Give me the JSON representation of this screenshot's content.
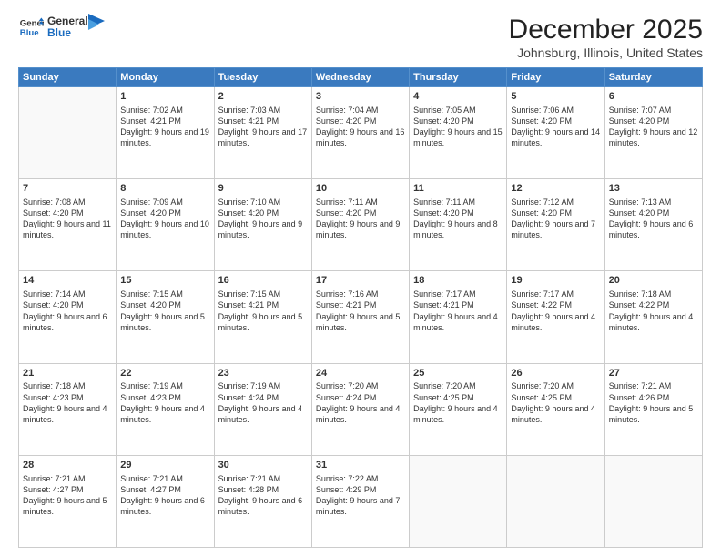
{
  "logo": {
    "line1": "General",
    "line2": "Blue"
  },
  "title": "December 2025",
  "location": "Johnsburg, Illinois, United States",
  "days_header": [
    "Sunday",
    "Monday",
    "Tuesday",
    "Wednesday",
    "Thursday",
    "Friday",
    "Saturday"
  ],
  "weeks": [
    [
      {
        "day": "",
        "empty": true
      },
      {
        "day": "1",
        "sunrise": "7:02 AM",
        "sunset": "4:21 PM",
        "daylight": "9 hours and 19 minutes."
      },
      {
        "day": "2",
        "sunrise": "7:03 AM",
        "sunset": "4:21 PM",
        "daylight": "9 hours and 17 minutes."
      },
      {
        "day": "3",
        "sunrise": "7:04 AM",
        "sunset": "4:20 PM",
        "daylight": "9 hours and 16 minutes."
      },
      {
        "day": "4",
        "sunrise": "7:05 AM",
        "sunset": "4:20 PM",
        "daylight": "9 hours and 15 minutes."
      },
      {
        "day": "5",
        "sunrise": "7:06 AM",
        "sunset": "4:20 PM",
        "daylight": "9 hours and 14 minutes."
      },
      {
        "day": "6",
        "sunrise": "7:07 AM",
        "sunset": "4:20 PM",
        "daylight": "9 hours and 12 minutes."
      }
    ],
    [
      {
        "day": "7",
        "sunrise": "7:08 AM",
        "sunset": "4:20 PM",
        "daylight": "9 hours and 11 minutes."
      },
      {
        "day": "8",
        "sunrise": "7:09 AM",
        "sunset": "4:20 PM",
        "daylight": "9 hours and 10 minutes."
      },
      {
        "day": "9",
        "sunrise": "7:10 AM",
        "sunset": "4:20 PM",
        "daylight": "9 hours and 9 minutes."
      },
      {
        "day": "10",
        "sunrise": "7:11 AM",
        "sunset": "4:20 PM",
        "daylight": "9 hours and 9 minutes."
      },
      {
        "day": "11",
        "sunrise": "7:11 AM",
        "sunset": "4:20 PM",
        "daylight": "9 hours and 8 minutes."
      },
      {
        "day": "12",
        "sunrise": "7:12 AM",
        "sunset": "4:20 PM",
        "daylight": "9 hours and 7 minutes."
      },
      {
        "day": "13",
        "sunrise": "7:13 AM",
        "sunset": "4:20 PM",
        "daylight": "9 hours and 6 minutes."
      }
    ],
    [
      {
        "day": "14",
        "sunrise": "7:14 AM",
        "sunset": "4:20 PM",
        "daylight": "9 hours and 6 minutes."
      },
      {
        "day": "15",
        "sunrise": "7:15 AM",
        "sunset": "4:20 PM",
        "daylight": "9 hours and 5 minutes."
      },
      {
        "day": "16",
        "sunrise": "7:15 AM",
        "sunset": "4:21 PM",
        "daylight": "9 hours and 5 minutes."
      },
      {
        "day": "17",
        "sunrise": "7:16 AM",
        "sunset": "4:21 PM",
        "daylight": "9 hours and 5 minutes."
      },
      {
        "day": "18",
        "sunrise": "7:17 AM",
        "sunset": "4:21 PM",
        "daylight": "9 hours and 4 minutes."
      },
      {
        "day": "19",
        "sunrise": "7:17 AM",
        "sunset": "4:22 PM",
        "daylight": "9 hours and 4 minutes."
      },
      {
        "day": "20",
        "sunrise": "7:18 AM",
        "sunset": "4:22 PM",
        "daylight": "9 hours and 4 minutes."
      }
    ],
    [
      {
        "day": "21",
        "sunrise": "7:18 AM",
        "sunset": "4:23 PM",
        "daylight": "9 hours and 4 minutes."
      },
      {
        "day": "22",
        "sunrise": "7:19 AM",
        "sunset": "4:23 PM",
        "daylight": "9 hours and 4 minutes."
      },
      {
        "day": "23",
        "sunrise": "7:19 AM",
        "sunset": "4:24 PM",
        "daylight": "9 hours and 4 minutes."
      },
      {
        "day": "24",
        "sunrise": "7:20 AM",
        "sunset": "4:24 PM",
        "daylight": "9 hours and 4 minutes."
      },
      {
        "day": "25",
        "sunrise": "7:20 AM",
        "sunset": "4:25 PM",
        "daylight": "9 hours and 4 minutes."
      },
      {
        "day": "26",
        "sunrise": "7:20 AM",
        "sunset": "4:25 PM",
        "daylight": "9 hours and 4 minutes."
      },
      {
        "day": "27",
        "sunrise": "7:21 AM",
        "sunset": "4:26 PM",
        "daylight": "9 hours and 5 minutes."
      }
    ],
    [
      {
        "day": "28",
        "sunrise": "7:21 AM",
        "sunset": "4:27 PM",
        "daylight": "9 hours and 5 minutes."
      },
      {
        "day": "29",
        "sunrise": "7:21 AM",
        "sunset": "4:27 PM",
        "daylight": "9 hours and 6 minutes."
      },
      {
        "day": "30",
        "sunrise": "7:21 AM",
        "sunset": "4:28 PM",
        "daylight": "9 hours and 6 minutes."
      },
      {
        "day": "31",
        "sunrise": "7:22 AM",
        "sunset": "4:29 PM",
        "daylight": "9 hours and 7 minutes."
      },
      {
        "day": "",
        "empty": true
      },
      {
        "day": "",
        "empty": true
      },
      {
        "day": "",
        "empty": true
      }
    ]
  ],
  "labels": {
    "sunrise": "Sunrise:",
    "sunset": "Sunset:",
    "daylight": "Daylight:"
  }
}
